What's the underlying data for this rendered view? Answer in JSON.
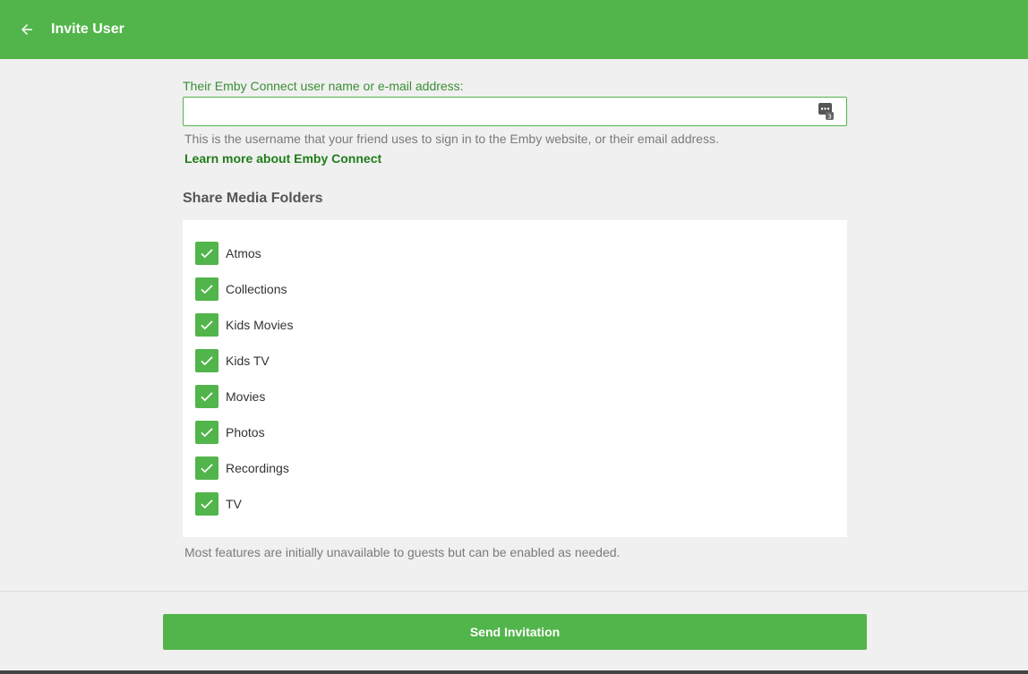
{
  "header": {
    "title": "Invite User",
    "back_icon": "arrow-left-icon",
    "bg_color": "#52b54b"
  },
  "form": {
    "username_label": "Their Emby Connect user name or e-mail address:",
    "username_value": "",
    "username_placeholder": "",
    "password_manager_icon": "password-manager-icon",
    "help_text": "This is the username that your friend uses to sign in to the Emby website, or their email address.",
    "learn_more_link": "Learn more about Emby Connect"
  },
  "share": {
    "title": "Share Media Folders",
    "folders": [
      {
        "label": "Atmos",
        "checked": true
      },
      {
        "label": "Collections",
        "checked": true
      },
      {
        "label": "Kids Movies",
        "checked": true
      },
      {
        "label": "Kids TV",
        "checked": true
      },
      {
        "label": "Movies",
        "checked": true
      },
      {
        "label": "Photos",
        "checked": true
      },
      {
        "label": "Recordings",
        "checked": true
      },
      {
        "label": "TV",
        "checked": true
      }
    ],
    "footnote": "Most features are initially unavailable to guests but can be enabled as needed."
  },
  "actions": {
    "send_label": "Send Invitation"
  },
  "colors": {
    "accent": "#52b54b",
    "link": "#1f7d19",
    "background": "#f0f0f0"
  }
}
